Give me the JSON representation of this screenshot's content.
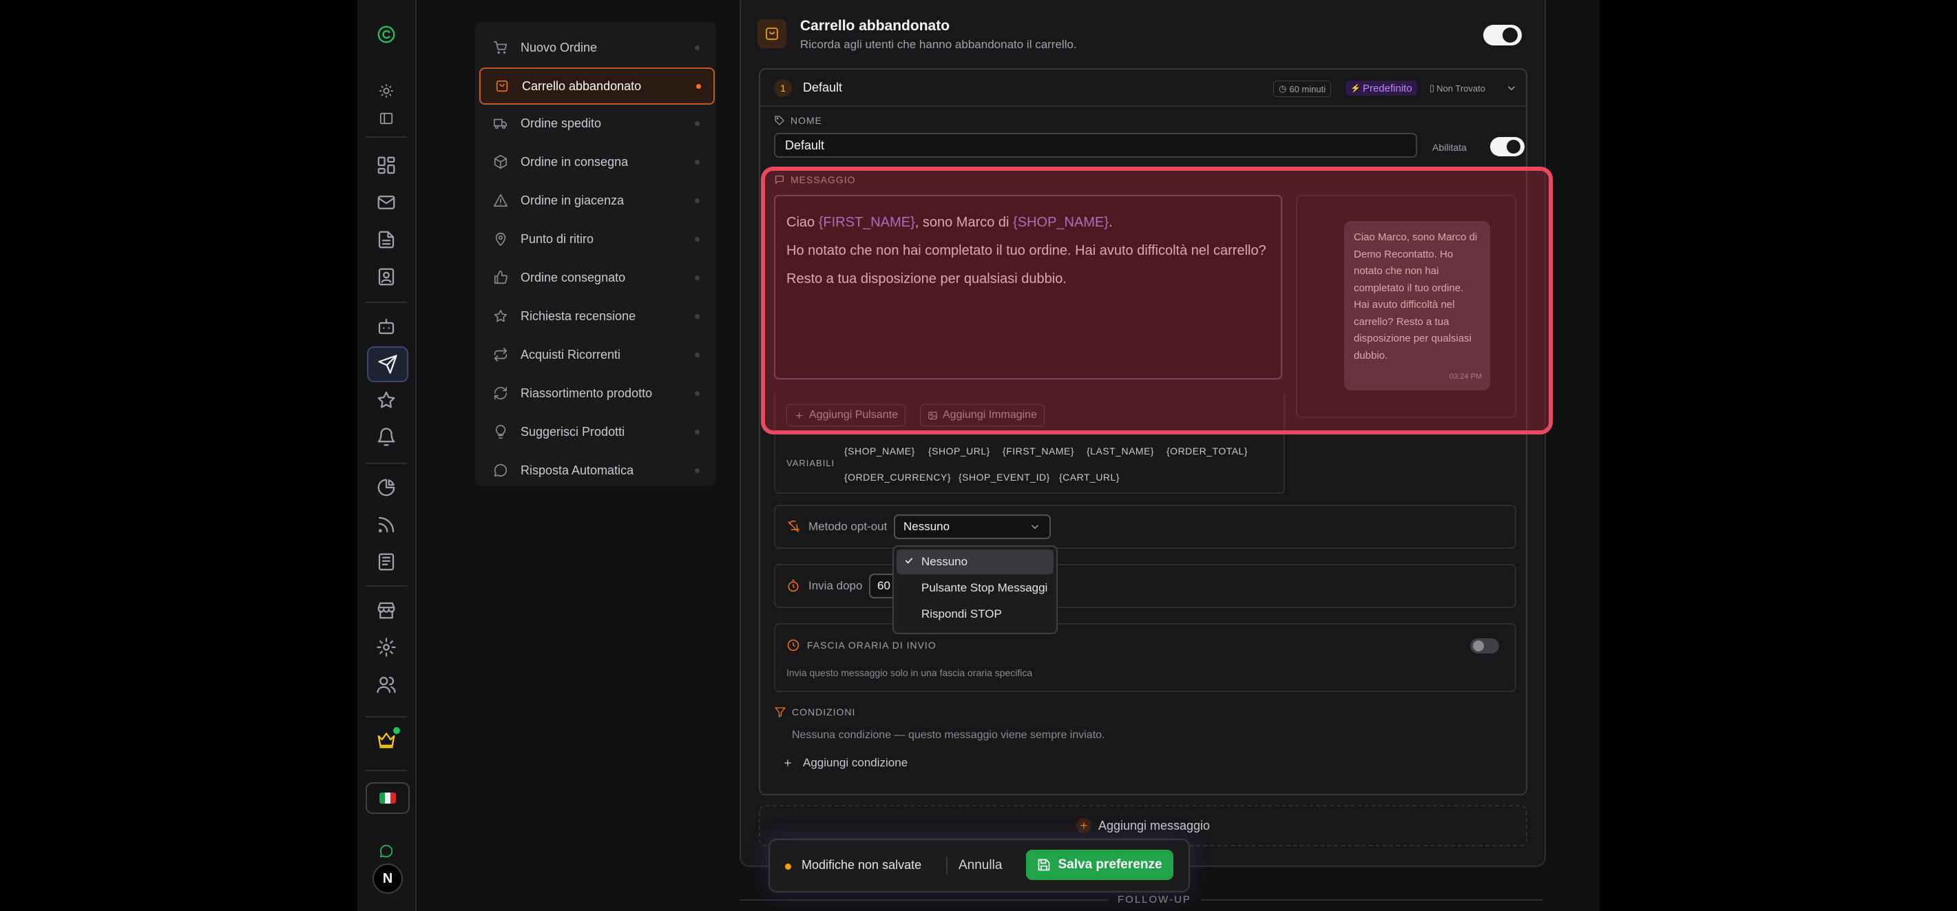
{
  "sidebar_nav": {
    "items": [
      {
        "label": "Nuovo Ordine",
        "icon": "cart-icon"
      },
      {
        "label": "Carrello abbandonato",
        "icon": "bag-icon",
        "active": true
      },
      {
        "label": "Ordine spedito",
        "icon": "truck-icon"
      },
      {
        "label": "Ordine in consegna",
        "icon": "package-icon"
      },
      {
        "label": "Ordine in giacenza",
        "icon": "warning-icon"
      },
      {
        "label": "Punto di ritiro",
        "icon": "pin-icon"
      },
      {
        "label": "Ordine consegnato",
        "icon": "thumb-up-icon"
      },
      {
        "label": "Richiesta recensione",
        "icon": "star-icon"
      },
      {
        "label": "Acquisti Ricorrenti",
        "icon": "repeat-icon"
      },
      {
        "label": "Riassortimento prodotto",
        "icon": "refresh-icon"
      },
      {
        "label": "Suggerisci Prodotti",
        "icon": "lightbulb-icon"
      },
      {
        "label": "Risposta Automatica",
        "icon": "chat-icon"
      }
    ]
  },
  "header": {
    "title": "Carrello abbandonato",
    "subtitle": "Ricorda agli utenti che hanno abbandonato il carrello."
  },
  "message_card": {
    "number": "1",
    "name": "Default",
    "badge_time": "60 minuti",
    "badge_default": "Predefinito",
    "badge_status": "Non Trovato"
  },
  "name_field": {
    "label": "NOME",
    "value": "Default",
    "enabled_label": "Abilitata"
  },
  "message": {
    "label": "MESSAGGIO",
    "text_line1_a": "Ciao ",
    "text_var1": "{FIRST_NAME}",
    "text_line1_b": ", sono Marco di ",
    "text_var2": "{SHOP_NAME}",
    "text_line1_c": ".",
    "text_line2": "Ho notato che non hai completato il tuo ordine. Hai avuto difficoltà nel carrello?",
    "text_line3": "Resto a tua disposizione per qualsiasi dubbio.",
    "add_button_label": "Aggiungi Pulsante",
    "add_image_label": "Aggiungi Immagine"
  },
  "preview": {
    "text": "Ciao Marco, sono Marco di Demo Recontatto. Ho notato che non hai completato il tuo ordine. Hai avuto difficoltà nel carrello? Resto a tua disposizione per qualsiasi dubbio.",
    "time": "03:24 PM"
  },
  "variables": {
    "label": "VARIABILI",
    "tokens": [
      "{SHOP_NAME}",
      "{SHOP_URL}",
      "{FIRST_NAME}",
      "{LAST_NAME}",
      "{ORDER_TOTAL}",
      "{ORDER_CURRENCY}",
      "{SHOP_EVENT_ID}",
      "{CART_URL}"
    ]
  },
  "opt_out": {
    "label": "Metodo opt-out",
    "selected": "Nessuno",
    "options": [
      "Nessuno",
      "Pulsante Stop Messaggi",
      "Rispondi STOP"
    ]
  },
  "send_after": {
    "label": "Invia dopo",
    "value": "60"
  },
  "time_window": {
    "label": "FASCIA ORARIA DI INVIO",
    "description": "Invia questo messaggio solo in una fascia oraria specifica"
  },
  "conditions": {
    "label": "CONDIZIONI",
    "note": "Nessuna condizione — questo messaggio viene sempre inviato.",
    "add_label": "Aggiungi condizione"
  },
  "add_message_label": "Aggiungi messaggio",
  "footer_section": "FOLLOW-UP",
  "unsaved_bar": {
    "text": "Modifiche non salvate",
    "cancel": "Annulla",
    "save": "Salva preferenze"
  }
}
